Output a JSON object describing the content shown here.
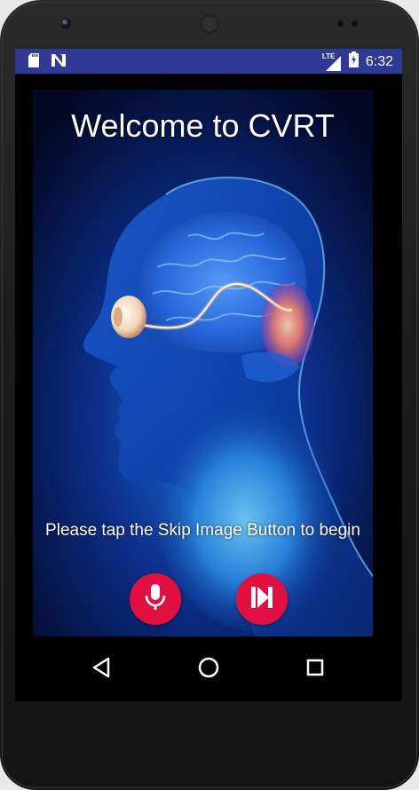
{
  "status_bar": {
    "time": "6:32",
    "network_label": "LTE",
    "icons": [
      "sd-card-icon",
      "n-notification-icon",
      "signal-icon",
      "battery-icon"
    ]
  },
  "app": {
    "title": "Welcome to CVRT",
    "instruction": "Please tap the Skip Image Button to begin",
    "buttons": {
      "mic": {
        "icon": "microphone-icon",
        "color": "#e11040"
      },
      "skip": {
        "icon": "skip-next-icon",
        "color": "#e11040"
      }
    }
  },
  "nav_bar": {
    "icons": [
      "back-icon",
      "home-icon",
      "recents-icon"
    ]
  },
  "colors": {
    "status_bar": "#2f3a97",
    "accent": "#e11040",
    "background": "#040a2c"
  }
}
